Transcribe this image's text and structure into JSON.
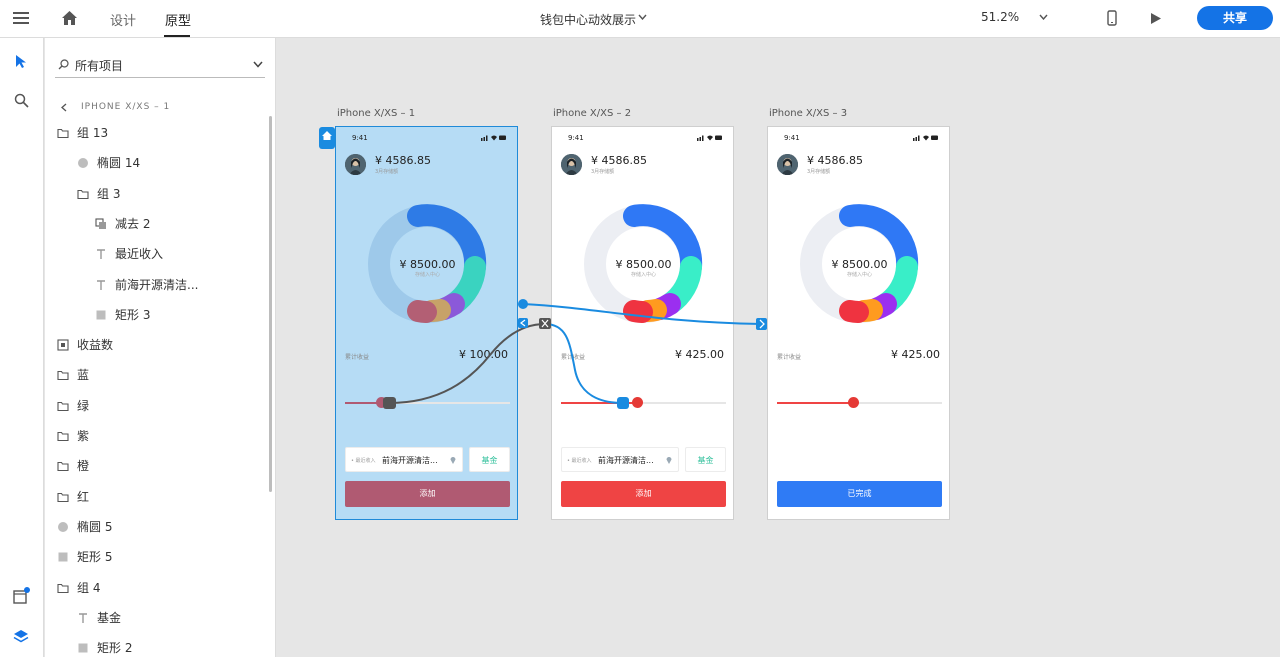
{
  "topbar": {
    "tabs": [
      {
        "label": "设计"
      },
      {
        "label": "原型"
      }
    ],
    "doc_title": "钱包中心动效展示",
    "zoom": "51.2%",
    "share_label": "共享"
  },
  "layers": {
    "filter_label": "所有项目",
    "breadcrumb": "IPHONE X/XS – 1",
    "items": [
      {
        "label": "组 13",
        "icon": "folder-icon"
      },
      {
        "label": "椭圆 14",
        "icon": "ellipse-icon"
      },
      {
        "label": "组 3",
        "icon": "folder-icon"
      },
      {
        "label": "减去 2",
        "icon": "subtract-icon"
      },
      {
        "label": "最近收入",
        "icon": "text-icon"
      },
      {
        "label": "前海开源清洁...",
        "icon": "text-icon"
      },
      {
        "label": "矩形 3",
        "icon": "rectangle-icon"
      },
      {
        "label": "收益数",
        "icon": "symbol-icon"
      },
      {
        "label": "蓝",
        "icon": "folder-icon"
      },
      {
        "label": "绿",
        "icon": "folder-icon"
      },
      {
        "label": "紫",
        "icon": "folder-icon"
      },
      {
        "label": "橙",
        "icon": "folder-icon"
      },
      {
        "label": "红",
        "icon": "folder-icon"
      },
      {
        "label": "椭圆 5",
        "icon": "ellipse-icon"
      },
      {
        "label": "矩形 5",
        "icon": "rectangle-icon"
      },
      {
        "label": "组 4",
        "icon": "folder-icon"
      },
      {
        "label": "基金",
        "icon": "text-icon"
      },
      {
        "label": "矩形 2",
        "icon": "rectangle-icon"
      }
    ]
  },
  "artboards": [
    {
      "label": "iPhone X/XS – 1",
      "time": "9:41",
      "amount": "¥ 4586.85",
      "amount_sub": "3月存储额",
      "center_value": "¥ 8500.00",
      "center_sub": "存储入中心",
      "earn_label": "累计收益",
      "earn_value": "¥ 100.00",
      "recent_label": "• 最近收入",
      "recent_value": "前海开源清洁...",
      "fund_label": "基金",
      "button_label": "添加",
      "slider_level": 0.22,
      "button_color": "#b05a72",
      "fill_color": "#b05a72",
      "knob_color": "#b05a72"
    },
    {
      "label": "iPhone X/XS – 2",
      "time": "9:41",
      "amount": "¥ 4586.85",
      "amount_sub": "3月存储额",
      "center_value": "¥ 8500.00",
      "center_sub": "存储入中心",
      "earn_label": "累计收益",
      "earn_value": "¥ 425.00",
      "recent_label": "• 最近收入",
      "recent_value": "前海开源清洁...",
      "fund_label": "基金",
      "button_label": "添加",
      "slider_level": 0.46,
      "button_color": "#ef4444",
      "fill_color": "#ef4444",
      "knob_color": "#e53935"
    },
    {
      "label": "iPhone X/XS – 3",
      "time": "9:41",
      "amount": "¥ 4586.85",
      "amount_sub": "3月存储额",
      "center_value": "¥ 8500.00",
      "center_sub": "存储入中心",
      "earn_label": "累计收益",
      "earn_value": "¥ 425.00",
      "recent_label": "",
      "recent_value": "",
      "fund_label": "",
      "button_label": "已完成",
      "slider_level": 0.46,
      "button_color": "#2f7bf5",
      "fill_color": "#ef4444",
      "knob_color": "#e53935"
    }
  ],
  "colors": {
    "accent": "#1473e6",
    "wire_blue": "#1a8be0",
    "wire_gray": "#555555"
  }
}
